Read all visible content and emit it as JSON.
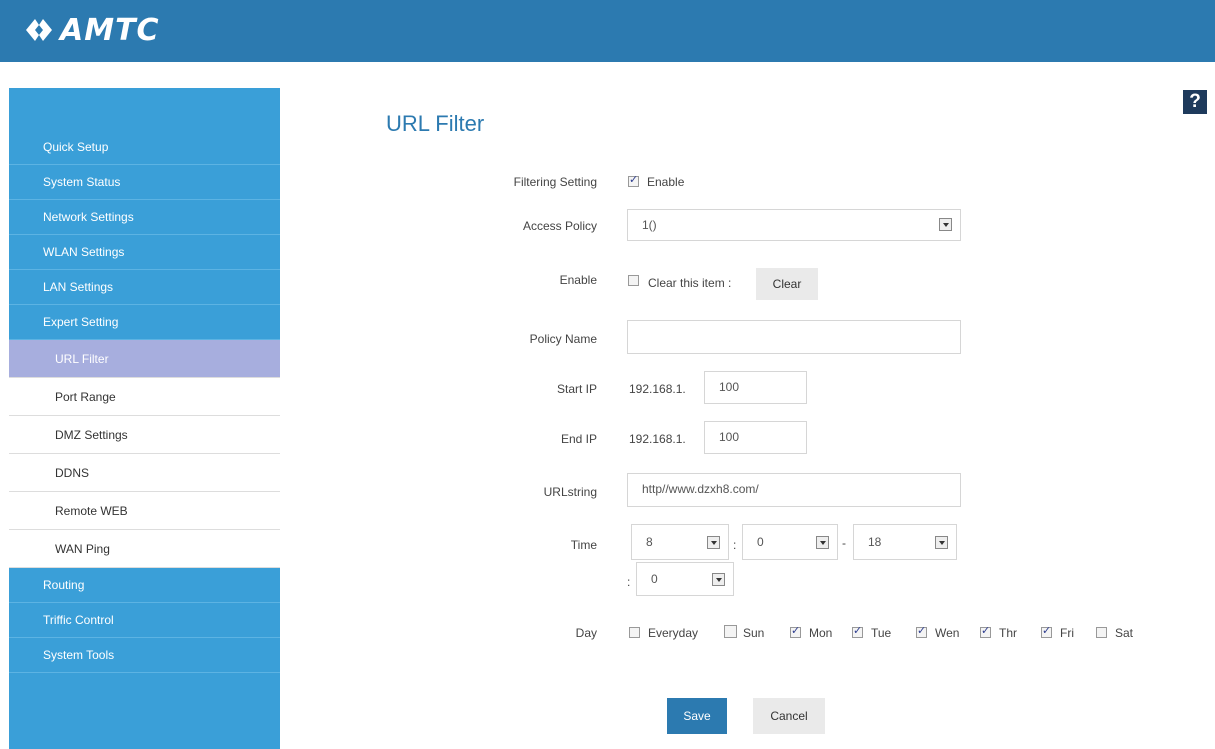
{
  "brand": {
    "name": "AMTC"
  },
  "sidebar": {
    "items": [
      {
        "label": "Quick Setup"
      },
      {
        "label": "System Status"
      },
      {
        "label": "Network Settings"
      },
      {
        "label": "WLAN Settings"
      },
      {
        "label": "LAN Settings"
      },
      {
        "label": "Expert Setting"
      }
    ],
    "subitems": [
      {
        "label": "URL Filter",
        "active": true
      },
      {
        "label": "Port Range"
      },
      {
        "label": "DMZ Settings"
      },
      {
        "label": "DDNS"
      },
      {
        "label": "Remote WEB"
      },
      {
        "label": "WAN Ping"
      }
    ],
    "items_after": [
      {
        "label": "Routing"
      },
      {
        "label": "Triffic Control"
      },
      {
        "label": "System Tools"
      }
    ]
  },
  "help": {
    "label": "?"
  },
  "page": {
    "title": "URL Filter"
  },
  "form": {
    "filtering_setting": {
      "label": "Filtering Setting",
      "checked": true,
      "option": "Enable"
    },
    "access_policy": {
      "label": "Access Policy",
      "value": "1()"
    },
    "enable": {
      "label": "Enable",
      "checked": false,
      "option": "Clear this item :",
      "button": "Clear"
    },
    "policy_name": {
      "label": "Policy Name",
      "value": ""
    },
    "start_ip": {
      "label": "Start IP",
      "prefix": "192.168.1.",
      "value": "100"
    },
    "end_ip": {
      "label": "End IP",
      "prefix": "192.168.1.",
      "value": "100"
    },
    "urlstring": {
      "label": "URLstring",
      "value": "http//www.dzxh8.com/"
    },
    "time": {
      "label": "Time",
      "start_hour": "8",
      "start_min": "0",
      "separator": "-",
      "end_hour": "18",
      "end_min": "0",
      "colon1": ":",
      "colon2": ":"
    },
    "day": {
      "label": "Day",
      "options": [
        {
          "label": "Everyday",
          "checked": false
        },
        {
          "label": "Sun",
          "checked": false
        },
        {
          "label": "Mon",
          "checked": true
        },
        {
          "label": "Tue",
          "checked": true
        },
        {
          "label": "Wen",
          "checked": true
        },
        {
          "label": "Thr",
          "checked": true
        },
        {
          "label": "Fri",
          "checked": true
        },
        {
          "label": "Sat",
          "checked": false
        }
      ]
    }
  },
  "actions": {
    "save": "Save",
    "cancel": "Cancel"
  },
  "colors": {
    "header": "#2c7ab0",
    "sidebar": "#3a9fd8",
    "active_sub": "#a7aede",
    "accent": "#2c7ab0"
  }
}
